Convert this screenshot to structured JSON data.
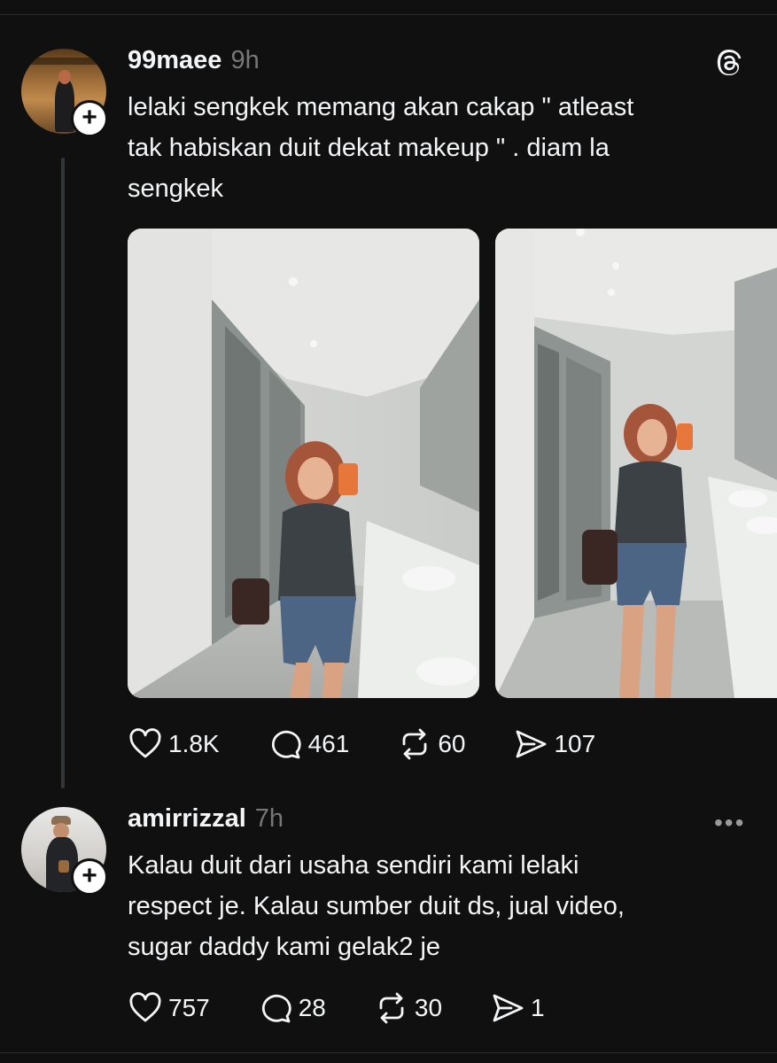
{
  "post": {
    "username": "99maee",
    "time": "9h",
    "text_lines": [
      "lelaki sengkek memang akan cakap \" atleast",
      "tak habiskan duit dekat makeup \" . diam la",
      "sengkek"
    ],
    "likes": "1.8K",
    "comments": "461",
    "reposts": "60",
    "shares": "107"
  },
  "reply": {
    "username": "amirrizzal",
    "time": "7h",
    "text_lines": [
      "Kalau duit dari usaha sendiri kami lelaki",
      "respect je. Kalau sumber duit ds, jual video,",
      "sugar daddy kami gelak2 je"
    ],
    "likes": "757",
    "comments": "28",
    "reposts": "30",
    "shares": "1",
    "more_icon": "ellipsis-icon"
  },
  "icons": {
    "logo": "threads-logo-icon",
    "like": "heart-icon",
    "comment": "comment-bubble-icon",
    "repost": "repost-icon",
    "share": "send-icon",
    "follow": "plus-icon"
  },
  "colors": {
    "background": "#101010",
    "text": "#f3f5f7",
    "muted": "#777777"
  }
}
